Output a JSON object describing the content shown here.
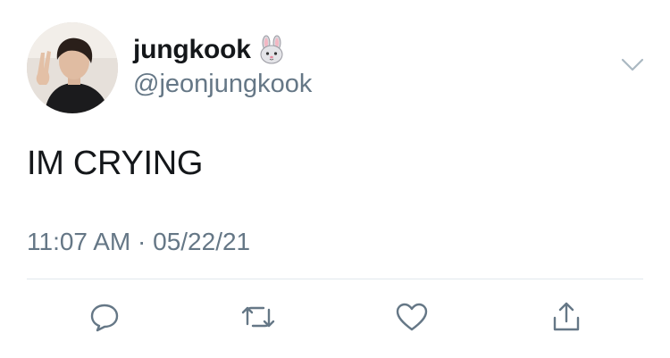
{
  "tweet": {
    "display_name": "jungkook",
    "handle": "@jeonjungkook",
    "text": "IM CRYING",
    "time": "11:07 AM",
    "separator": " · ",
    "date": "05/22/21"
  },
  "icons": {
    "badge": "rabbit-face-icon",
    "menu": "chevron-down-icon",
    "reply": "reply-icon",
    "retweet": "retweet-icon",
    "like": "heart-icon",
    "share": "share-icon"
  },
  "colors": {
    "text": "#14171a",
    "secondary": "#657786",
    "icon": "#657786",
    "divider": "#e1e8ed"
  }
}
